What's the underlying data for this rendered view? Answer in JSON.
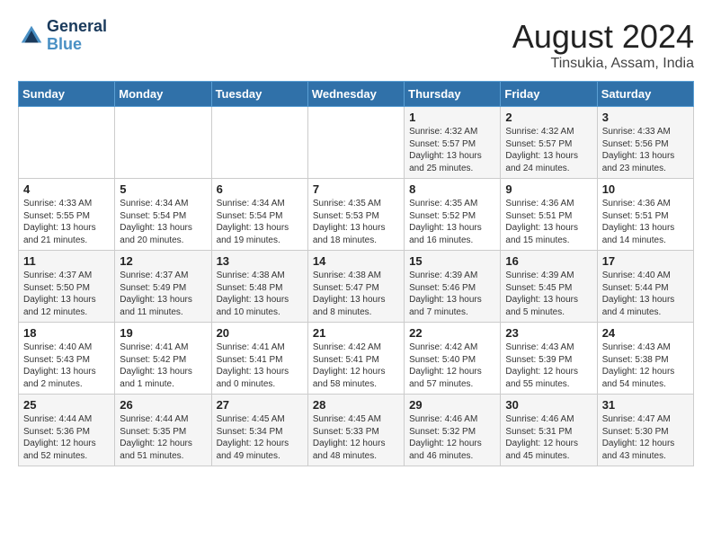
{
  "logo": {
    "line1": "General",
    "line2": "Blue"
  },
  "title": "August 2024",
  "subtitle": "Tinsukia, Assam, India",
  "days_of_week": [
    "Sunday",
    "Monday",
    "Tuesday",
    "Wednesday",
    "Thursday",
    "Friday",
    "Saturday"
  ],
  "weeks": [
    [
      {
        "num": "",
        "info": ""
      },
      {
        "num": "",
        "info": ""
      },
      {
        "num": "",
        "info": ""
      },
      {
        "num": "",
        "info": ""
      },
      {
        "num": "1",
        "info": "Sunrise: 4:32 AM\nSunset: 5:57 PM\nDaylight: 13 hours\nand 25 minutes."
      },
      {
        "num": "2",
        "info": "Sunrise: 4:32 AM\nSunset: 5:57 PM\nDaylight: 13 hours\nand 24 minutes."
      },
      {
        "num": "3",
        "info": "Sunrise: 4:33 AM\nSunset: 5:56 PM\nDaylight: 13 hours\nand 23 minutes."
      }
    ],
    [
      {
        "num": "4",
        "info": "Sunrise: 4:33 AM\nSunset: 5:55 PM\nDaylight: 13 hours\nand 21 minutes."
      },
      {
        "num": "5",
        "info": "Sunrise: 4:34 AM\nSunset: 5:54 PM\nDaylight: 13 hours\nand 20 minutes."
      },
      {
        "num": "6",
        "info": "Sunrise: 4:34 AM\nSunset: 5:54 PM\nDaylight: 13 hours\nand 19 minutes."
      },
      {
        "num": "7",
        "info": "Sunrise: 4:35 AM\nSunset: 5:53 PM\nDaylight: 13 hours\nand 18 minutes."
      },
      {
        "num": "8",
        "info": "Sunrise: 4:35 AM\nSunset: 5:52 PM\nDaylight: 13 hours\nand 16 minutes."
      },
      {
        "num": "9",
        "info": "Sunrise: 4:36 AM\nSunset: 5:51 PM\nDaylight: 13 hours\nand 15 minutes."
      },
      {
        "num": "10",
        "info": "Sunrise: 4:36 AM\nSunset: 5:51 PM\nDaylight: 13 hours\nand 14 minutes."
      }
    ],
    [
      {
        "num": "11",
        "info": "Sunrise: 4:37 AM\nSunset: 5:50 PM\nDaylight: 13 hours\nand 12 minutes."
      },
      {
        "num": "12",
        "info": "Sunrise: 4:37 AM\nSunset: 5:49 PM\nDaylight: 13 hours\nand 11 minutes."
      },
      {
        "num": "13",
        "info": "Sunrise: 4:38 AM\nSunset: 5:48 PM\nDaylight: 13 hours\nand 10 minutes."
      },
      {
        "num": "14",
        "info": "Sunrise: 4:38 AM\nSunset: 5:47 PM\nDaylight: 13 hours\nand 8 minutes."
      },
      {
        "num": "15",
        "info": "Sunrise: 4:39 AM\nSunset: 5:46 PM\nDaylight: 13 hours\nand 7 minutes."
      },
      {
        "num": "16",
        "info": "Sunrise: 4:39 AM\nSunset: 5:45 PM\nDaylight: 13 hours\nand 5 minutes."
      },
      {
        "num": "17",
        "info": "Sunrise: 4:40 AM\nSunset: 5:44 PM\nDaylight: 13 hours\nand 4 minutes."
      }
    ],
    [
      {
        "num": "18",
        "info": "Sunrise: 4:40 AM\nSunset: 5:43 PM\nDaylight: 13 hours\nand 2 minutes."
      },
      {
        "num": "19",
        "info": "Sunrise: 4:41 AM\nSunset: 5:42 PM\nDaylight: 13 hours\nand 1 minute."
      },
      {
        "num": "20",
        "info": "Sunrise: 4:41 AM\nSunset: 5:41 PM\nDaylight: 13 hours\nand 0 minutes."
      },
      {
        "num": "21",
        "info": "Sunrise: 4:42 AM\nSunset: 5:41 PM\nDaylight: 12 hours\nand 58 minutes."
      },
      {
        "num": "22",
        "info": "Sunrise: 4:42 AM\nSunset: 5:40 PM\nDaylight: 12 hours\nand 57 minutes."
      },
      {
        "num": "23",
        "info": "Sunrise: 4:43 AM\nSunset: 5:39 PM\nDaylight: 12 hours\nand 55 minutes."
      },
      {
        "num": "24",
        "info": "Sunrise: 4:43 AM\nSunset: 5:38 PM\nDaylight: 12 hours\nand 54 minutes."
      }
    ],
    [
      {
        "num": "25",
        "info": "Sunrise: 4:44 AM\nSunset: 5:36 PM\nDaylight: 12 hours\nand 52 minutes."
      },
      {
        "num": "26",
        "info": "Sunrise: 4:44 AM\nSunset: 5:35 PM\nDaylight: 12 hours\nand 51 minutes."
      },
      {
        "num": "27",
        "info": "Sunrise: 4:45 AM\nSunset: 5:34 PM\nDaylight: 12 hours\nand 49 minutes."
      },
      {
        "num": "28",
        "info": "Sunrise: 4:45 AM\nSunset: 5:33 PM\nDaylight: 12 hours\nand 48 minutes."
      },
      {
        "num": "29",
        "info": "Sunrise: 4:46 AM\nSunset: 5:32 PM\nDaylight: 12 hours\nand 46 minutes."
      },
      {
        "num": "30",
        "info": "Sunrise: 4:46 AM\nSunset: 5:31 PM\nDaylight: 12 hours\nand 45 minutes."
      },
      {
        "num": "31",
        "info": "Sunrise: 4:47 AM\nSunset: 5:30 PM\nDaylight: 12 hours\nand 43 minutes."
      }
    ]
  ]
}
